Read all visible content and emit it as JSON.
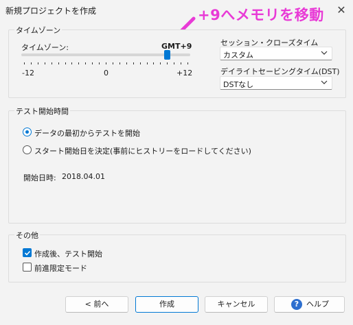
{
  "window": {
    "title": "新規プロジェクトを作成",
    "close_glyph": "✕"
  },
  "annotation": {
    "text": "+9へメモリを移動",
    "color": "#e83ad6"
  },
  "timezone_group": {
    "label": "タイムゾーン",
    "slider_label": "タイムゾーン:",
    "current_value": "GMT+9",
    "slider": {
      "min": -12,
      "max": 12,
      "value": 9
    },
    "tick_labels": {
      "min": "-12",
      "mid": "0",
      "max": "+12"
    },
    "session_close_label": "セッション・クローズタイム",
    "session_close_value": "カスタム",
    "dst_label": "デイライトセービングタイム(DST)",
    "dst_value": "DSTなし"
  },
  "test_start_group": {
    "label": "テスト開始時間",
    "option_from_start": "データの最初からテストを開始",
    "option_set_date": "スタート開始日を決定(事前にヒストリーをロードしてください)",
    "selected": "from_start",
    "start_datetime_label": "開始日時:",
    "start_datetime_value": "2018.04.01"
  },
  "other_group": {
    "label": "その他",
    "after_create_label": "作成後、テスト開始",
    "after_create_checked": true,
    "forward_only_label": "前進限定モード",
    "forward_only_checked": false
  },
  "buttons": {
    "back": "< 前へ",
    "create": "作成",
    "cancel": "キャンセル",
    "help": "ヘルプ",
    "help_glyph": "?"
  },
  "colors": {
    "accent": "#0078d4",
    "annotation": "#e83ad6"
  }
}
